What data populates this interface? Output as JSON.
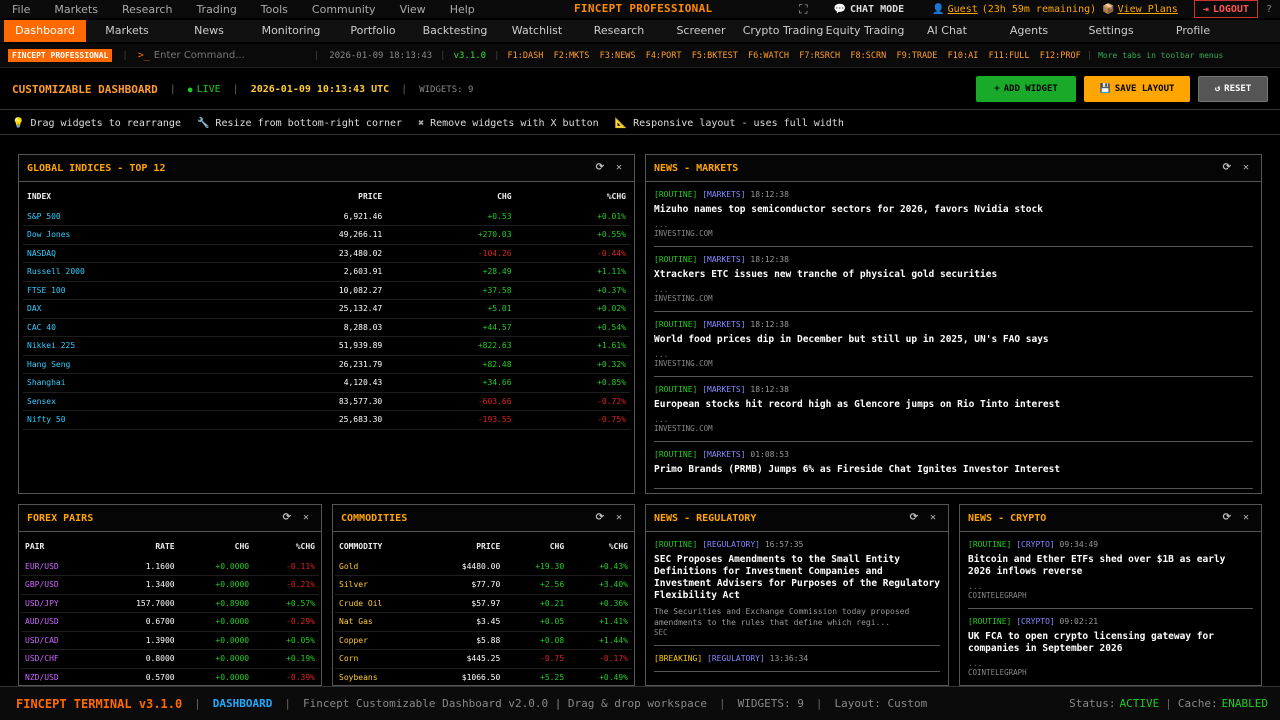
{
  "menu": {
    "items": [
      "File",
      "Markets",
      "Research",
      "Trading",
      "Tools",
      "Community",
      "View",
      "Help"
    ],
    "brand": "FINCEPT PROFESSIONAL",
    "chat_mode": "CHAT MODE",
    "user": "Guest",
    "remaining": "(23h 59m remaining)",
    "plans": "View Plans",
    "logout": "LOGOUT",
    "help": "?"
  },
  "tabs": [
    "Dashboard",
    "Markets",
    "News",
    "Monitoring",
    "Portfolio",
    "Backtesting",
    "Watchlist",
    "Research",
    "Screener",
    "Crypto Trading",
    "Equity Trading",
    "AI Chat",
    "Agents",
    "Settings",
    "Profile"
  ],
  "cmd": {
    "badge": "FINCEPT PROFESSIONAL",
    "placeholder": "Enter Command...",
    "datetime": "2026-01-09 18:13:43",
    "version": "v3.1.0",
    "shortcuts": "F1:DASH  F2:MKTS  F3:NEWS  F4:PORT  F5:BKTEST  F6:WATCH  F7:RSRCH  F8:SCRN  F9:TRADE  F10:AI  F11:FULL  F12:PROF",
    "more": "More tabs in toolbar menus"
  },
  "header": {
    "title": "CUSTOMIZABLE DASHBOARD",
    "live": "LIVE",
    "time": "2026-01-09 10:13:43 UTC",
    "widgets": "WIDGETS: 9",
    "add": "ADD WIDGET",
    "save": "SAVE LAYOUT",
    "reset": "RESET"
  },
  "tips": [
    "Drag widgets to rearrange",
    "Resize from bottom-right corner",
    "Remove widgets with X button",
    "Responsive layout - uses full width"
  ],
  "indices": {
    "title": "GLOBAL INDICES - TOP 12",
    "cols": [
      "INDEX",
      "PRICE",
      "CHG",
      "%CHG"
    ],
    "rows": [
      [
        "S&P 500",
        "6,921.46",
        "+0.53",
        "+0.01%"
      ],
      [
        "Dow Jones",
        "49,266.11",
        "+270.03",
        "+0.55%"
      ],
      [
        "NASDAQ",
        "23,480.02",
        "-104.26",
        "-0.44%"
      ],
      [
        "Russell 2000",
        "2,603.91",
        "+28.49",
        "+1.11%"
      ],
      [
        "FTSE 100",
        "10,082.27",
        "+37.58",
        "+0.37%"
      ],
      [
        "DAX",
        "25,132.47",
        "+5.01",
        "+0.02%"
      ],
      [
        "CAC 40",
        "8,288.03",
        "+44.57",
        "+0.54%"
      ],
      [
        "Nikkei 225",
        "51,939.89",
        "+822.63",
        "+1.61%"
      ],
      [
        "Hang Seng",
        "26,231.79",
        "+82.48",
        "+0.32%"
      ],
      [
        "Shanghai",
        "4,120.43",
        "+34.66",
        "+0.85%"
      ],
      [
        "Sensex",
        "83,577.30",
        "-603.66",
        "-0.72%"
      ],
      [
        "Nifty 50",
        "25,683.30",
        "-193.55",
        "-0.75%"
      ]
    ]
  },
  "news_markets": {
    "title": "NEWS - MARKETS",
    "items": [
      {
        "tag": "[ROUTINE]",
        "cat": "[MARKETS]",
        "time": "18:12:38",
        "title": "Mizuho names top semiconductor sectors for 2026, favors Nvidia stock",
        "dots": "...",
        "src": "INVESTING.COM"
      },
      {
        "tag": "[ROUTINE]",
        "cat": "[MARKETS]",
        "time": "18:12:38",
        "title": "Xtrackers ETC issues new tranche of physical gold securities",
        "dots": "...",
        "src": "INVESTING.COM"
      },
      {
        "tag": "[ROUTINE]",
        "cat": "[MARKETS]",
        "time": "18:12:38",
        "title": "World food prices dip in December but still up in 2025, UN's FAO says",
        "dots": "...",
        "src": "INVESTING.COM"
      },
      {
        "tag": "[ROUTINE]",
        "cat": "[MARKETS]",
        "time": "18:12:38",
        "title": "European stocks hit record high as Glencore jumps on Rio Tinto interest",
        "dots": "...",
        "src": "INVESTING.COM"
      },
      {
        "tag": "[ROUTINE]",
        "cat": "[MARKETS]",
        "time": "01:08:53",
        "title": "Primo Brands (PRMB) Jumps 6% as Fireside Chat Ignites Investor Interest",
        "dots": "",
        "src": ""
      }
    ]
  },
  "forex": {
    "title": "FOREX PAIRS",
    "cols": [
      "PAIR",
      "RATE",
      "CHG",
      "%CHG"
    ],
    "rows": [
      [
        "EUR/USD",
        "1.1600",
        "+0.0000",
        "-0.11%"
      ],
      [
        "GBP/USD",
        "1.3400",
        "+0.0000",
        "-0.21%"
      ],
      [
        "USD/JPY",
        "157.7000",
        "+0.8900",
        "+0.57%"
      ],
      [
        "AUD/USD",
        "0.6700",
        "+0.0000",
        "-0.29%"
      ],
      [
        "USD/CAD",
        "1.3900",
        "+0.0000",
        "+0.05%"
      ],
      [
        "USD/CHF",
        "0.8000",
        "+0.0000",
        "+0.19%"
      ],
      [
        "NZD/USD",
        "0.5700",
        "+0.0000",
        "-0.39%"
      ]
    ]
  },
  "commodities": {
    "title": "COMMODITIES",
    "cols": [
      "COMMODITY",
      "PRICE",
      "CHG",
      "%CHG"
    ],
    "rows": [
      [
        "Gold",
        "$4480.00",
        "+19.30",
        "+0.43%"
      ],
      [
        "Silver",
        "$77.70",
        "+2.56",
        "+3.40%"
      ],
      [
        "Crude Oil",
        "$57.97",
        "+0.21",
        "+0.36%"
      ],
      [
        "Nat Gas",
        "$3.45",
        "+0.05",
        "+1.41%"
      ],
      [
        "Copper",
        "$5.88",
        "+0.08",
        "+1.44%"
      ],
      [
        "Corn",
        "$445.25",
        "-0.75",
        "-0.17%"
      ],
      [
        "Soybeans",
        "$1066.50",
        "+5.25",
        "+0.49%"
      ]
    ]
  },
  "news_reg": {
    "title": "NEWS - REGULATORY",
    "items": [
      {
        "tag": "[ROUTINE]",
        "cat": "[REGULATORY]",
        "time": "16:57:35",
        "title": "SEC Proposes Amendments to the Small Entity Definitions for Investment Companies and Investment Advisers for Purposes of the Regulatory Flexibility Act",
        "summary": "The Securities and Exchange Commission today proposed amendments to the rules that define which regi...",
        "src": "SEC"
      },
      {
        "tag": "[BREAKING]",
        "cat": "[REGULATORY]",
        "time": "13:36:34",
        "title": "",
        "summary": "",
        "src": ""
      }
    ]
  },
  "news_crypto": {
    "title": "NEWS - CRYPTO",
    "items": [
      {
        "tag": "[ROUTINE]",
        "cat": "[CRYPTO]",
        "time": "09:34:49",
        "title": "Bitcoin and Ether ETFs shed over $1B as early 2026 inflows reverse",
        "dots": "...",
        "src": "COINTELEGRAPH"
      },
      {
        "tag": "[ROUTINE]",
        "cat": "[CRYPTO]",
        "time": "09:02:21",
        "title": "UK FCA to open crypto licensing gateway for companies in September 2026",
        "dots": "...",
        "src": "COINTELEGRAPH"
      }
    ]
  },
  "status": {
    "app": "FINCEPT TERMINAL v3.1.0",
    "view": "DASHBOARD",
    "desc": "Fincept Customizable Dashboard v2.0.0 | Drag & drop workspace",
    "widgets": "WIDGETS: 9",
    "layout": "Layout: Custom",
    "status_label": "Status:",
    "status_val": "ACTIVE",
    "cache_label": "Cache:",
    "cache_val": "ENABLED"
  }
}
